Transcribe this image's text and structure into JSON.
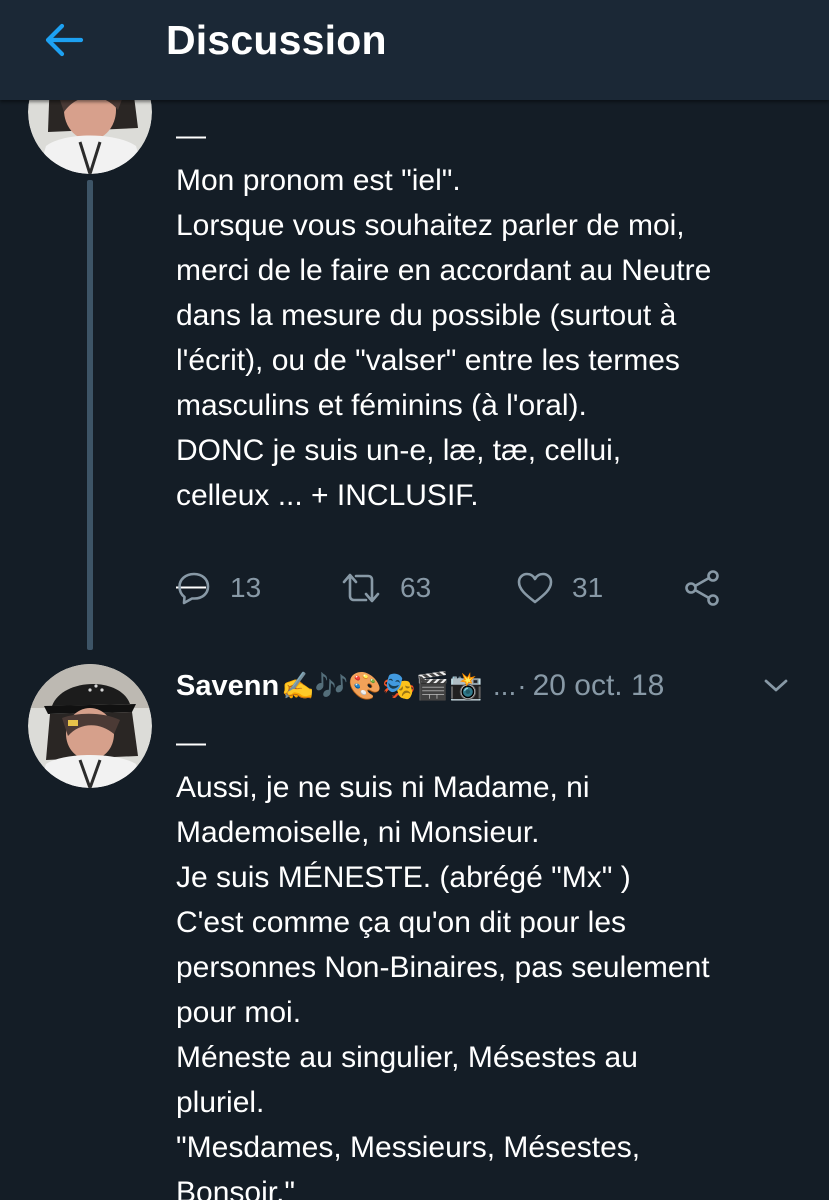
{
  "header": {
    "title": "Discussion",
    "back_icon": "arrow-left-icon",
    "accent_color": "#1da1f2"
  },
  "tweet1": {
    "text_lines": [
      "—",
      "Mon pronom est \"iel\".",
      "Lorsque vous souhaitez parler de moi,",
      "merci de le faire en accordant au Neutre",
      "dans la mesure du possible (surtout à",
      "l'écrit), ou de \"valser\" entre les termes",
      "masculins et féminins (à l'oral).",
      "DONC je suis un-e, læ, tæ, cellui,",
      "celleux ... + INCLUSIF.",
      "",
      "—"
    ],
    "actions": {
      "reply_count": "13",
      "retweet_count": "63",
      "like_count": "31"
    }
  },
  "tweet2": {
    "display_name": "Savenn",
    "name_emoji": "✍️🎶🎨🎭🎬📸",
    "ellipsis": "...",
    "separator": "·",
    "timestamp": "20 oct. 18",
    "text_lines": [
      "—",
      "Aussi, je ne suis ni Madame, ni",
      "Mademoiselle, ni Monsieur.",
      "Je suis MÉNESTE.  (abrégé  \"Mx\" )",
      "C'est comme ça qu'on dit pour les",
      "personnes Non-Binaires, pas seulement",
      "pour moi.",
      "Méneste au singulier, Mésestes au",
      "pluriel.",
      "\"Mesdames, Messieurs, Mésestes,",
      "Bonsoir.\""
    ]
  },
  "colors": {
    "background": "#141d26",
    "header_bg": "#1b2836",
    "text_primary": "#ffffff",
    "text_secondary": "#8899a6",
    "thread_line": "#3d5466"
  }
}
